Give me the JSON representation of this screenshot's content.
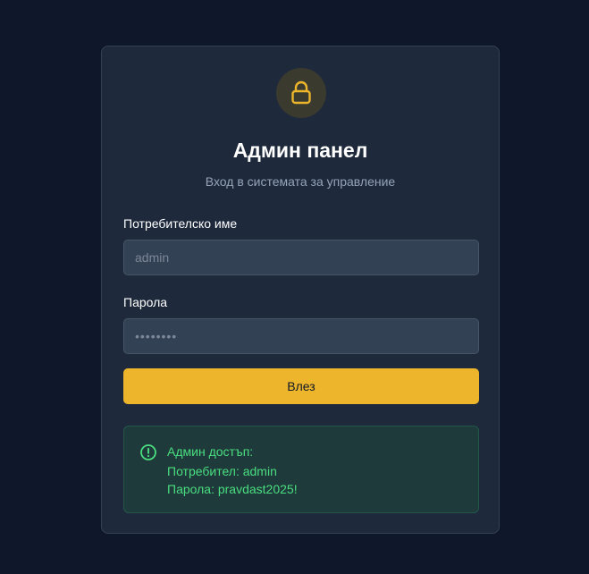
{
  "colors": {
    "background": "#0f172a",
    "card": "#1e293b",
    "accent": "#ecb52b",
    "success_text": "#4ade80"
  },
  "header": {
    "icon": "lock-icon",
    "title": "Админ панел",
    "subtitle": "Вход в системата за управление"
  },
  "form": {
    "username_label": "Потребителско име",
    "username_placeholder": "admin",
    "password_label": "Парола",
    "password_placeholder": "••••••••",
    "submit_label": "Влез"
  },
  "info": {
    "icon": "info-circle-icon",
    "title": "Админ достъп:",
    "username_line": "Потребител: admin",
    "password_line": "Парола: pravdast2025!"
  }
}
